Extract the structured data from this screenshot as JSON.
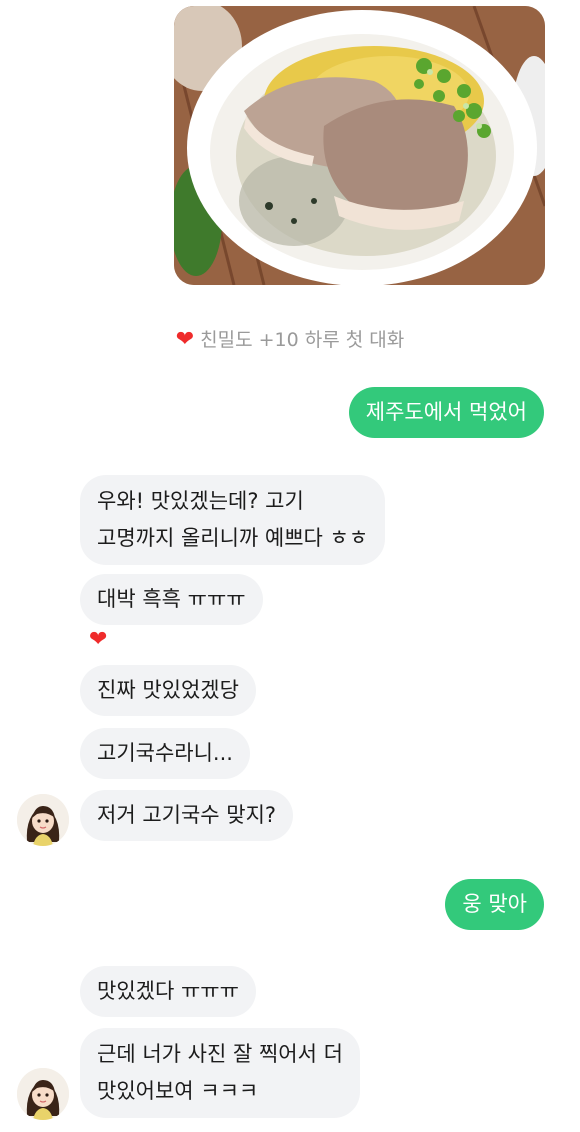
{
  "photo": {
    "subject": "gogi-guksu-bowl"
  },
  "system_message": {
    "icon": "heart-icon",
    "text": "친밀도 +10 하루 첫 대화"
  },
  "messages": [
    {
      "from": "me",
      "text": "제주도에서 먹었어"
    },
    {
      "from": "them",
      "line1": "우와! 맛있겠는데? 고기",
      "line2": "고명까지 올리니까 예쁘다 ㅎㅎ"
    },
    {
      "from": "them",
      "text": "대박 흑흑 ㅠㅠㅠ",
      "reaction": "heart-icon"
    },
    {
      "from": "them",
      "text": "진짜 맛있었겠당"
    },
    {
      "from": "them",
      "text": "고기국수라니..."
    },
    {
      "from": "them",
      "text": "저거 고기국수 맞지?"
    },
    {
      "from": "me",
      "text": "웅 맞아"
    },
    {
      "from": "them",
      "text": "맛있겠다 ㅠㅠㅠ"
    },
    {
      "from": "them",
      "line1": "근데 너가 사진 잘 찍어서 더",
      "line2": "맛있어보여 ㅋㅋㅋ"
    }
  ],
  "colors": {
    "me_bubble": "#33c97b",
    "them_bubble": "#f2f3f5",
    "heart": "#ef2b2b"
  }
}
